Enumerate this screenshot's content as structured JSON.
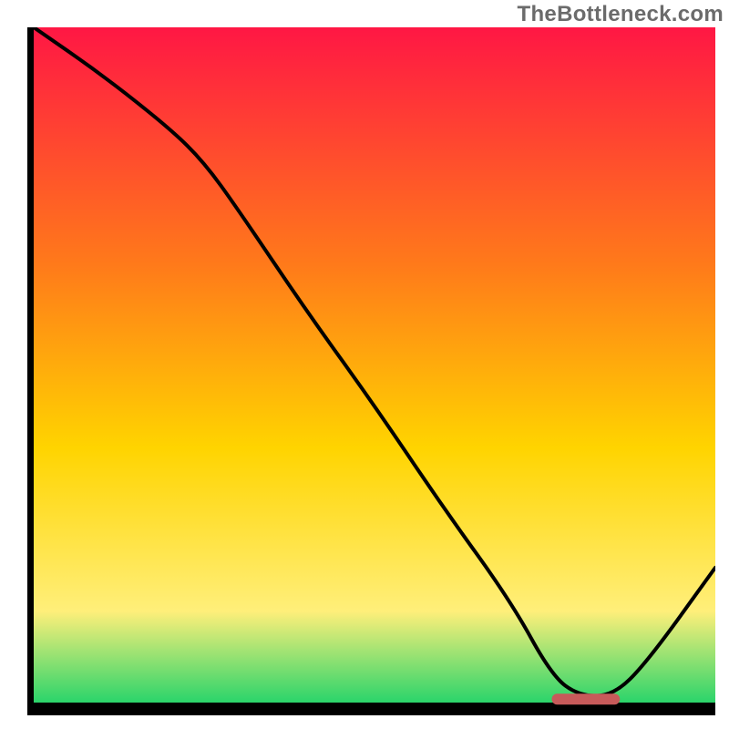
{
  "brand": {
    "watermark_text": "TheBottleneck.com"
  },
  "chart_data": {
    "type": "line",
    "title": "",
    "xlabel": "",
    "ylabel": "",
    "xlim": [
      0,
      100
    ],
    "ylim": [
      0,
      100
    ],
    "notes": "Background is a vertical green→yellow→orange→red gradient. Black curve shows bottleneck magnitude, dipping to near zero around x≈78–85. A dark-red rounded marker highlights the optimal (lowest) region at y≈0.",
    "series": [
      {
        "name": "bottleneck-curve",
        "x": [
          0,
          10,
          20,
          25,
          30,
          40,
          50,
          60,
          70,
          76,
          80,
          85,
          90,
          100
        ],
        "values": [
          100,
          93,
          85,
          80,
          73,
          58,
          44,
          29,
          15,
          4,
          1,
          1,
          6,
          20
        ]
      }
    ],
    "marker": {
      "x_start": 76,
      "x_end": 86,
      "y": 0.5
    },
    "colors": {
      "gradient_top": "#ff1744",
      "gradient_mid1": "#ff7a1a",
      "gradient_mid2": "#ffd400",
      "gradient_mid3": "#ffef7a",
      "gradient_bottom": "#22d36a",
      "curve": "#000000",
      "marker": "#c75a5a",
      "axis": "#000000"
    }
  }
}
